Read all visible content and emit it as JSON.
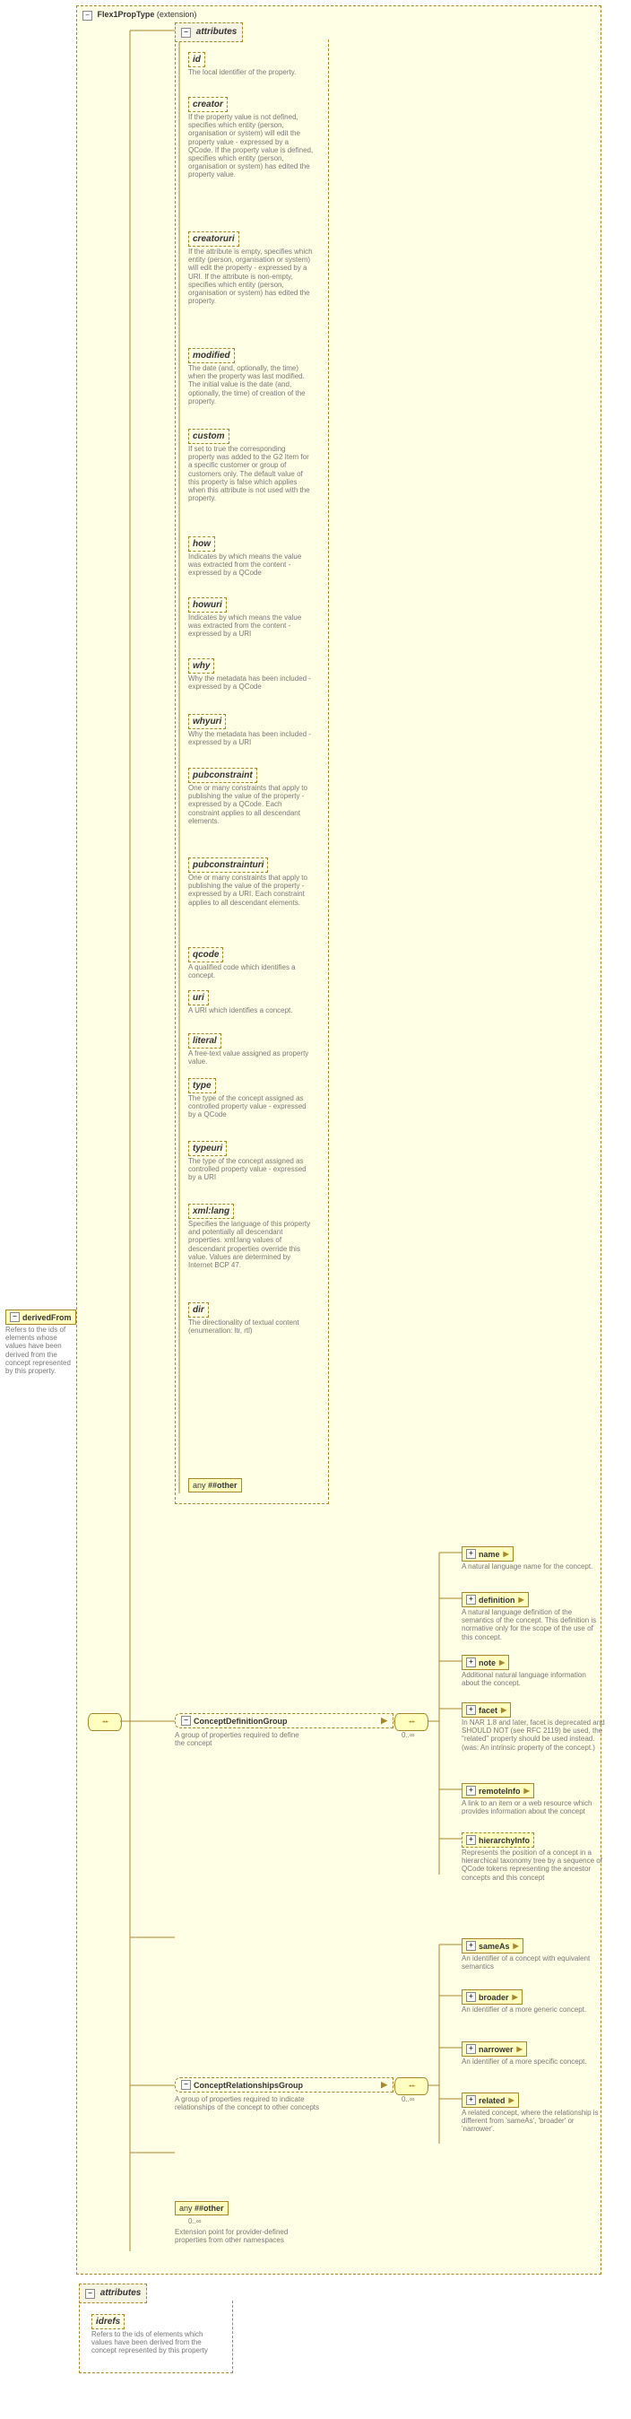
{
  "extension": {
    "name": "Flex1PropType",
    "label": "(extension)"
  },
  "root": {
    "name": "derivedFrom",
    "desc": "Refers to the ids of elements whose values have been derived from the concept represented by this property."
  },
  "attrs_top_label": "attributes",
  "attrs_top": [
    {
      "name": "id",
      "desc": "The local identifier of the property."
    },
    {
      "name": "creator",
      "desc": "If the property value is not defined, specifies which entity (person, organisation or system) will edit the property value - expressed by a QCode. If the property value is defined, specifies which entity (person, organisation or system) has edited the property value."
    },
    {
      "name": "creatoruri",
      "desc": "If the attribute is empty, specifies which entity (person, organisation or system) will edit the property - expressed by a URI. If the attribute is non-empty, specifies which entity (person, organisation or system) has edited the property."
    },
    {
      "name": "modified",
      "desc": "The date (and, optionally, the time) when the property was last modified. The initial value is the date (and, optionally, the time) of creation of the property."
    },
    {
      "name": "custom",
      "desc": "If set to true the corresponding property was added to the G2 Item for a specific customer or group of customers only. The default value of this property is false which applies when this attribute is not used with the property."
    },
    {
      "name": "how",
      "desc": "Indicates by which means the value was extracted from the content - expressed by a QCode"
    },
    {
      "name": "howuri",
      "desc": "Indicates by which means the value was extracted from the content - expressed by a URI"
    },
    {
      "name": "why",
      "desc": "Why the metadata has been included - expressed by a QCode"
    },
    {
      "name": "whyuri",
      "desc": "Why the metadata has been included - expressed by a URI"
    },
    {
      "name": "pubconstraint",
      "desc": "One or many constraints that apply to publishing the value of the property - expressed by a QCode. Each constraint applies to all descendant elements."
    },
    {
      "name": "pubconstrainturi",
      "desc": "One or many constraints that apply to publishing the value of the property - expressed by a URI. Each constraint applies to all descendant elements."
    },
    {
      "name": "qcode",
      "desc": "A qualified code which identifies a concept."
    },
    {
      "name": "uri",
      "desc": "A URI which identifies a concept."
    },
    {
      "name": "literal",
      "desc": "A free-text value assigned as property value."
    },
    {
      "name": "type",
      "desc": "The type of the concept assigned as controlled property value - expressed by a QCode"
    },
    {
      "name": "typeuri",
      "desc": "The type of the concept assigned as controlled property value - expressed by a URI"
    },
    {
      "name": "xml:lang",
      "desc": "Specifies the language of this property and potentially all descendant properties. xml:lang values of descendant properties override this value. Values are determined by Internet BCP 47."
    },
    {
      "name": "dir",
      "desc": "The directionality of textual content (enumeration: ltr, rtl)"
    }
  ],
  "any_top": "##other",
  "defGroup": {
    "name": "ConceptDefinitionGroup",
    "desc": "A group of properties required to define the concept",
    "occ": "0..∞",
    "items": [
      {
        "name": "name",
        "desc": "A natural language name for the concept.",
        "solid": true
      },
      {
        "name": "definition",
        "desc": "A natural language definition of the semantics of the concept. This definition is normative only for the scope of the use of this concept.",
        "solid": true
      },
      {
        "name": "note",
        "desc": "Additional natural language information about the concept.",
        "solid": true
      },
      {
        "name": "facet",
        "desc": "In NAR 1.8 and later, facet is deprecated and SHOULD NOT (see RFC 2119) be used, the \"related\" property should be used instead.(was: An intrinsic property of the concept.)",
        "solid": true
      },
      {
        "name": "remoteInfo",
        "desc": "A link to an item or a web resource which provides information about the concept",
        "solid": true
      },
      {
        "name": "hierarchyInfo",
        "desc": "Represents the position of a concept in a hierarchical taxonomy tree by a sequence of QCode tokens representing the ancestor concepts and this concept",
        "solid": false
      }
    ]
  },
  "relGroup": {
    "name": "ConceptRelationshipsGroup",
    "desc": "A group of properties required to indicate relationships of the concept to other concepts",
    "occ": "0..∞",
    "items": [
      {
        "name": "sameAs",
        "desc": "An identifier of a concept with equivalent semantics",
        "solid": true
      },
      {
        "name": "broader",
        "desc": "An identifier of a more generic concept.",
        "solid": true
      },
      {
        "name": "narrower",
        "desc": "An identifier of a more specific concept.",
        "solid": true
      },
      {
        "name": "related",
        "desc": "A related concept, where the relationship is different from 'sameAs', 'broader' or 'narrower'.",
        "solid": true
      }
    ]
  },
  "any_bottom": {
    "label": "##other",
    "occ": "0..∞",
    "desc": "Extension point for provider-defined properties from other namespaces"
  },
  "attrs_bottom": {
    "label": "attributes",
    "name": "idrefs",
    "desc": "Refers to the ids of elements which  values have been derived from the concept represented by this property"
  },
  "chart_data": {
    "type": "table",
    "note": "XSD content model diagram; no quantitative chart data."
  }
}
